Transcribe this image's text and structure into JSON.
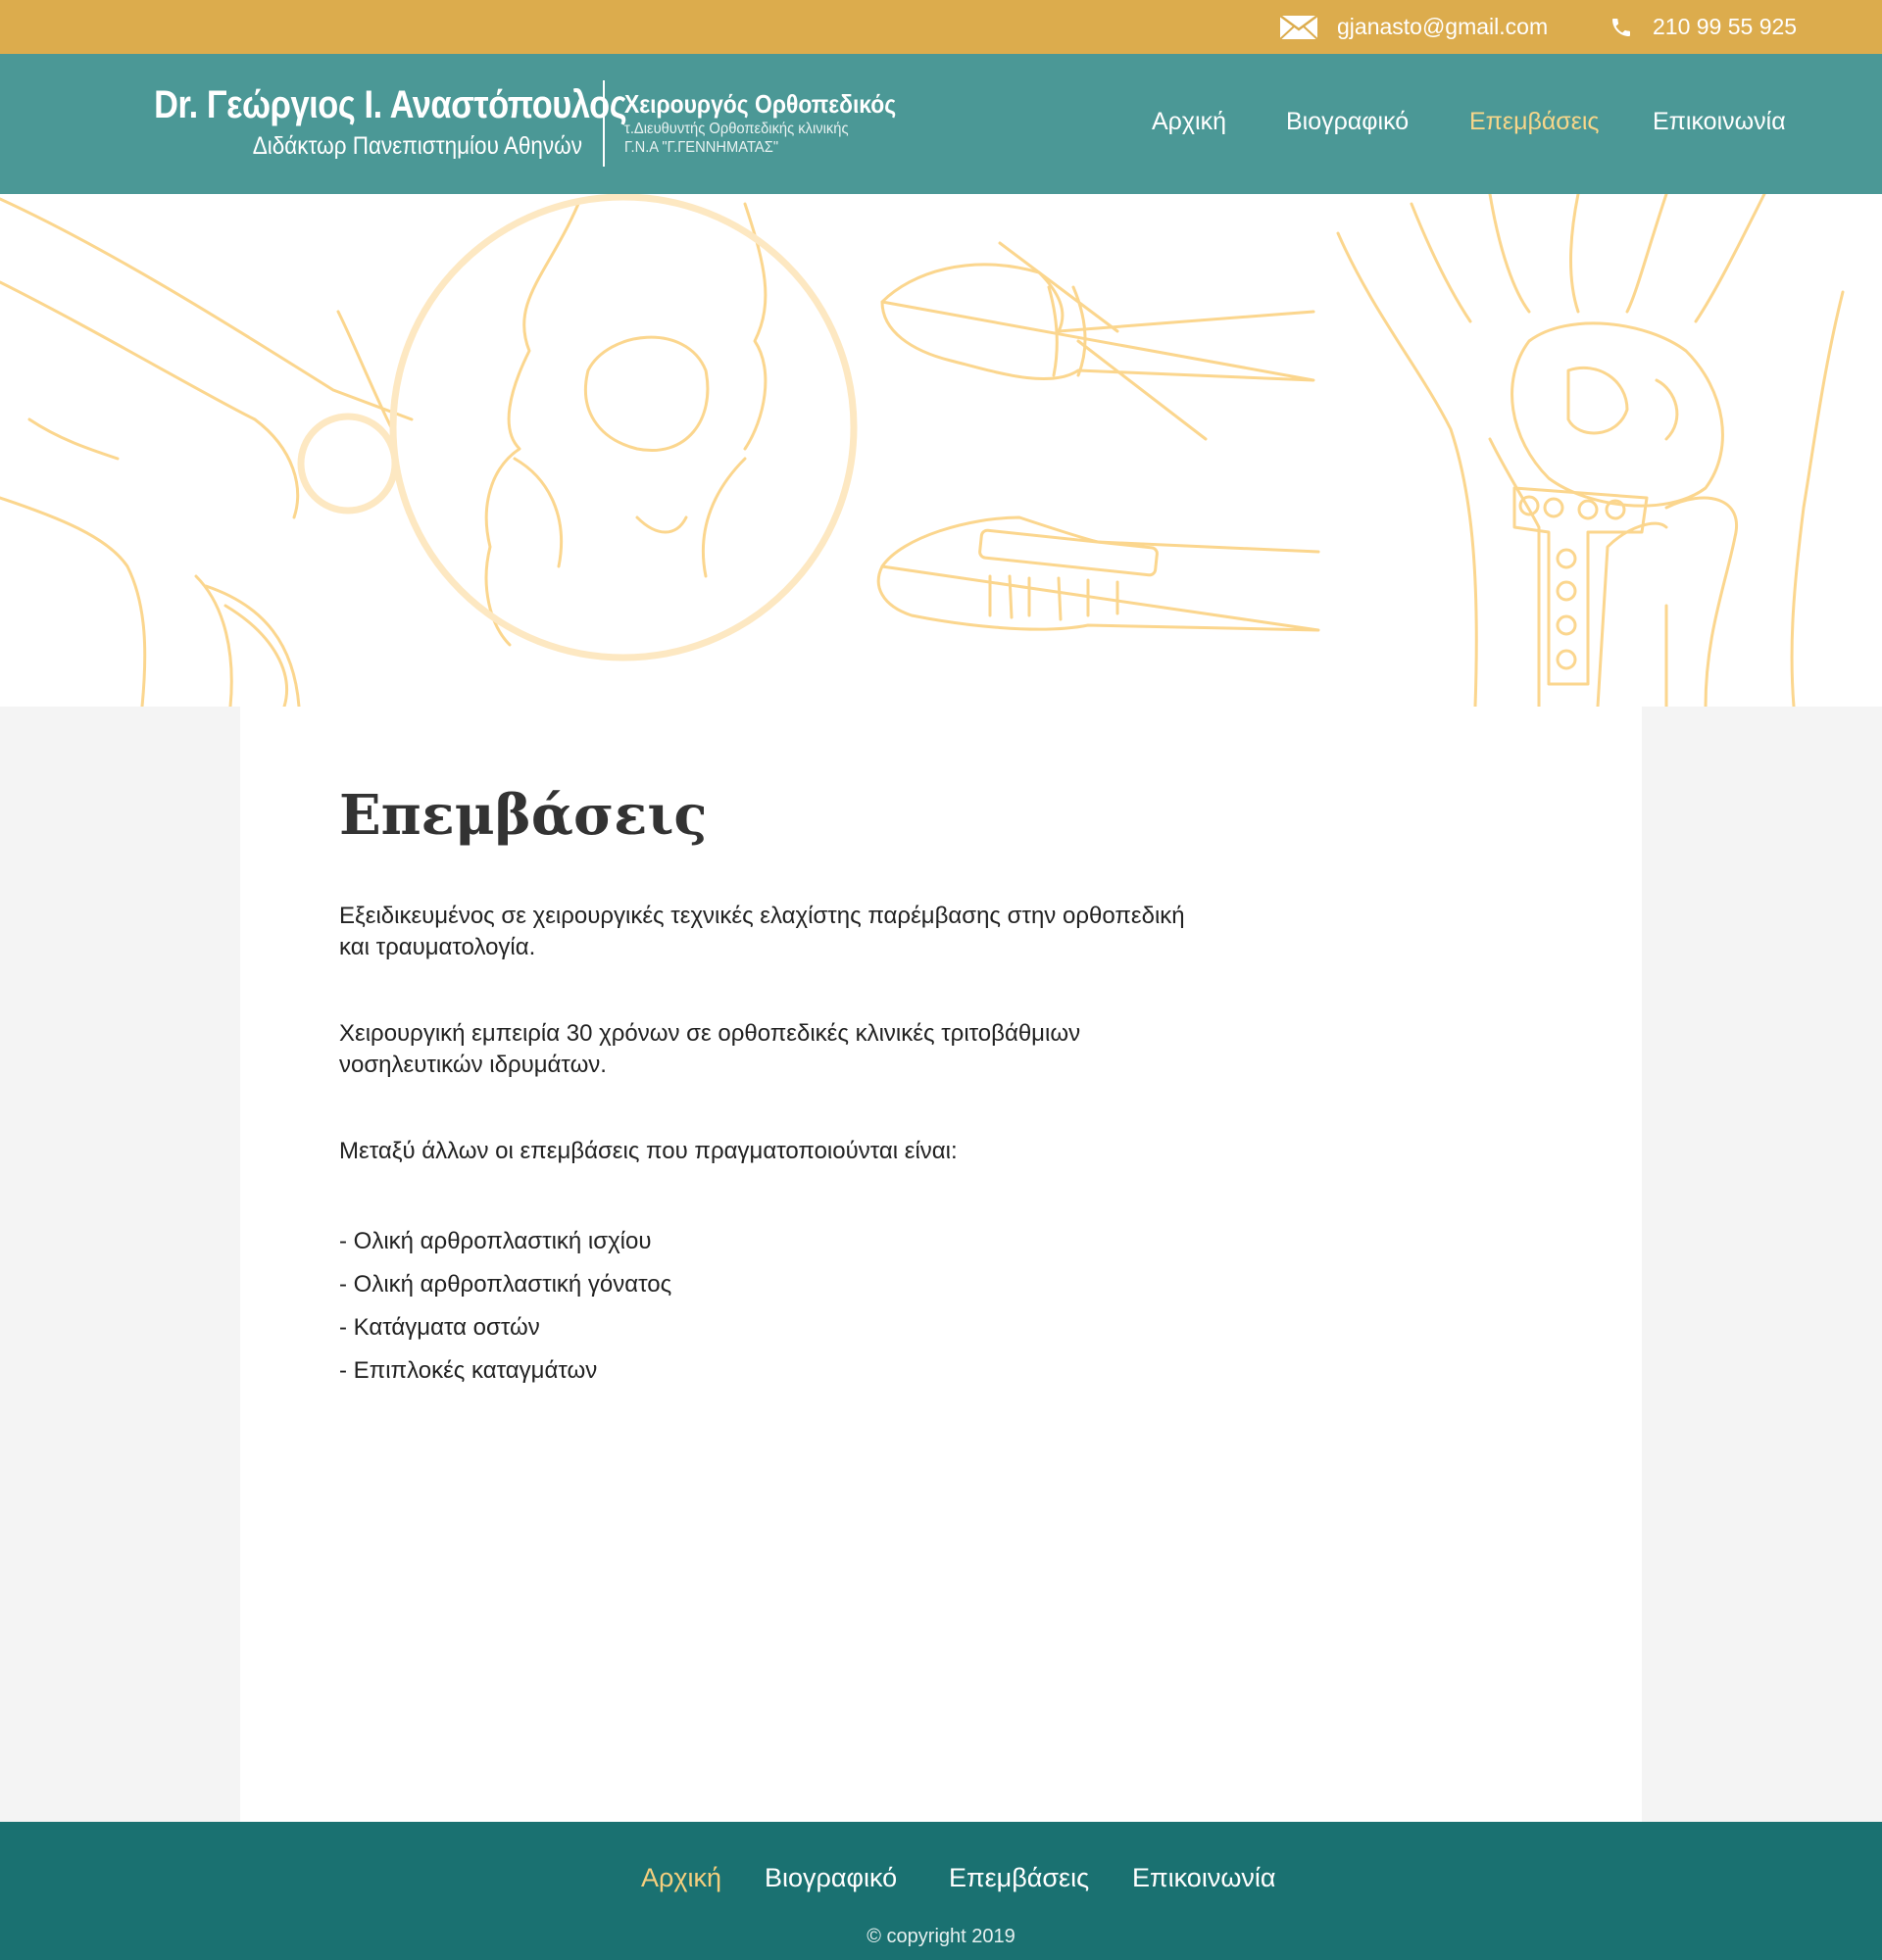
{
  "topbar": {
    "email": "gjanasto@gmail.com",
    "phone": "210 99 55 925"
  },
  "header": {
    "brand_name": "Dr. Γεώργιος Ι. Αναστόπουλος",
    "brand_subtitle": "Διδάκτωρ Πανεπιστημίου Αθηνών",
    "specialty_title": "Χειρουργός Ορθοπεδικός",
    "specialty_line1": "τ.Διευθυντής Ορθοπεδικής κλινικής",
    "specialty_line2": "Γ.Ν.Α \"Γ.ΓΕΝΝΗΜΑΤΑΣ\"",
    "nav": [
      {
        "label": "Αρχική",
        "active": false
      },
      {
        "label": "Βιογραφικό",
        "active": false
      },
      {
        "label": "Επεμβάσεις",
        "active": true
      },
      {
        "label": "Επικοινωνία",
        "active": false
      }
    ]
  },
  "main": {
    "title": "Επεμβάσεις",
    "paragraphs": [
      "Εξειδικευμένος σε χειρουργικές τεχνικές ελαχίστης παρέμβασης στην ορθοπεδική και τραυματολογία.",
      "Χειρουργική εμπειρία 30 χρόνων σε ορθοπεδικές κλινικές τριτοβάθμιων νοσηλευτικών ιδρυμάτων.",
      "Μεταξύ άλλων οι επεμβάσεις που πραγματοποιούνται είναι:"
    ],
    "procedures": [
      "- Ολική αρθροπλαστική ισχίου",
      "- Ολική αρθροπλαστική γόνατος",
      "- Κατάγματα οστών",
      "- Επιπλοκές καταγμάτων"
    ]
  },
  "footer": {
    "nav": [
      {
        "label": "Αρχική",
        "active": true
      },
      {
        "label": "Βιογραφικό",
        "active": false
      },
      {
        "label": "Επεμβάσεις",
        "active": false
      },
      {
        "label": "Επικοινωνία",
        "active": false
      }
    ],
    "copyright": "© copyright 2019"
  },
  "colors": {
    "topbar": "#dcac4d",
    "header": "#4b9896",
    "footer": "#1a7171",
    "accent": "#f5cf7e",
    "illustration": "#fbd68e"
  },
  "icons": [
    "envelope-icon",
    "phone-icon"
  ]
}
